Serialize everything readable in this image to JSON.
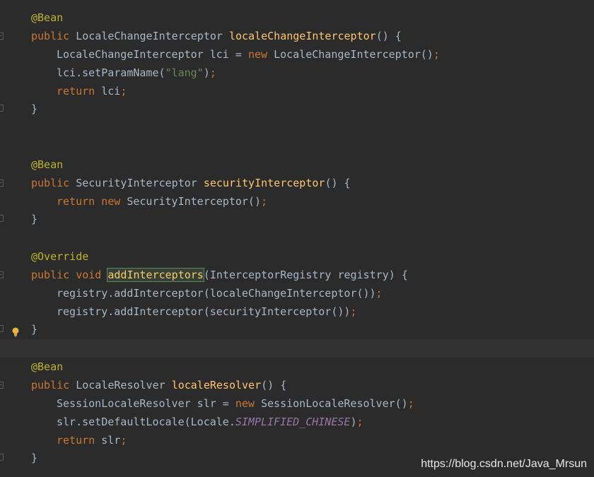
{
  "colors": {
    "background": "#2b2b2b",
    "text": "#a9b7c6",
    "keyword": "#cc7832",
    "annotation": "#bbb529",
    "method_name": "#ffc66d",
    "string": "#6a8759",
    "constant": "#9876aa"
  },
  "icons": {
    "intention": "lightbulb-icon",
    "fold": "fold-marker-icon"
  },
  "code": {
    "ann_bean": "@Bean",
    "ann_override": "@Override",
    "kw_public": "public",
    "kw_void": "void",
    "kw_new": "new",
    "kw_return": "return",
    "semicolon": ";",
    "open_brace": "{",
    "close_brace": "}",
    "m1": {
      "type": "LocaleChangeInterceptor",
      "name": "localeChangeInterceptor",
      "params": "()",
      "l1_decl": "LocaleChangeInterceptor lci = ",
      "l1_ctor": "LocaleChangeInterceptor()",
      "l2_call": "lci.setParamName(",
      "l2_str": "\"lang\"",
      "l2_close": ")",
      "l3_var": "lci"
    },
    "m2": {
      "type": "SecurityInterceptor",
      "name": "securityInterceptor",
      "params": "()",
      "l1_ctor": "SecurityInterceptor()"
    },
    "m3": {
      "name": "addInterceptors",
      "params": "(InterceptorRegistry registry)",
      "l1": "registry.addInterceptor(localeChangeInterceptor())",
      "l2": "registry.addInterceptor(securityInterceptor())"
    },
    "m4": {
      "type": "LocaleResolver",
      "name": "localeResolver",
      "params": "()",
      "l1_decl": "SessionLocaleResolver slr = ",
      "l1_ctor": "SessionLocaleResolver()",
      "l2_call": "slr.setDefaultLocale(Locale.",
      "l2_const": "SIMPLIFIED_CHINESE",
      "l2_close": ")",
      "l3_var": "slr"
    }
  },
  "watermark": "https://blog.csdn.net/Java_Mrsun"
}
